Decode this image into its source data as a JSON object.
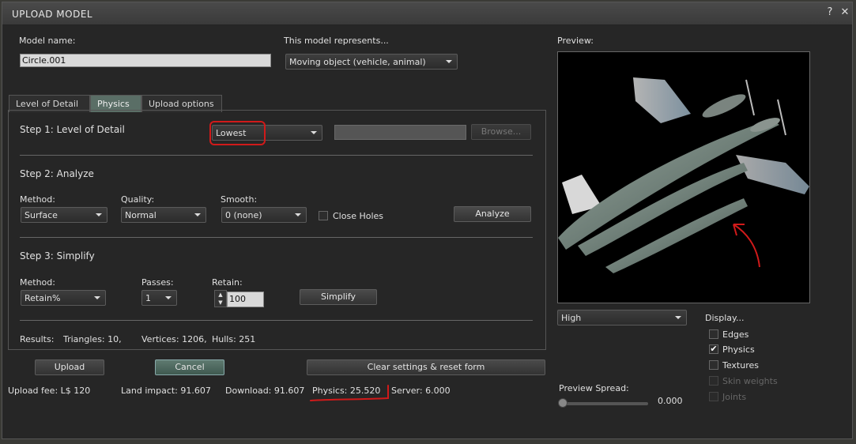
{
  "window": {
    "title": "UPLOAD MODEL",
    "help_glyph": "?",
    "close_glyph": "✕"
  },
  "model": {
    "name_label": "Model name:",
    "name_value": "Circle.001",
    "represents_label": "This model represents...",
    "represents_value": "Moving object (vehicle, animal)"
  },
  "tabs": [
    "Level of Detail",
    "Physics",
    "Upload options"
  ],
  "active_tab": "Physics",
  "step1": {
    "title": "Step 1: Level of Detail",
    "lod_value": "Lowest",
    "browse_label": "Browse..."
  },
  "step2": {
    "title": "Step 2: Analyze",
    "method_label": "Method:",
    "method_value": "Surface",
    "quality_label": "Quality:",
    "quality_value": "Normal",
    "smooth_label": "Smooth:",
    "smooth_value": "0 (none)",
    "close_holes_label": "Close Holes",
    "analyze_label": "Analyze"
  },
  "step3": {
    "title": "Step 3: Simplify",
    "method_label": "Method:",
    "method_value": "Retain%",
    "passes_label": "Passes:",
    "passes_value": "1",
    "retain_label": "Retain:",
    "retain_value": "100",
    "simplify_label": "Simplify"
  },
  "results": {
    "label": "Results:",
    "triangles": "Triangles: 10,",
    "vertices": "Vertices: 1206,",
    "hulls": "Hulls: 251"
  },
  "buttons": {
    "upload": "Upload",
    "cancel": "Cancel",
    "clear": "Clear settings & reset form"
  },
  "stats": {
    "upload_fee": "Upload fee: L$ 120",
    "land_impact": "Land impact: 91.607",
    "download": "Download: 91.607",
    "physics": "Physics: 25.520",
    "server": "Server: 6.000"
  },
  "preview": {
    "label": "Preview:",
    "quality_value": "High",
    "spread_label": "Preview Spread:",
    "spread_value": "0.000",
    "display_label": "Display...",
    "display_options": [
      {
        "label": "Edges",
        "checked": false,
        "enabled": true
      },
      {
        "label": "Physics",
        "checked": true,
        "enabled": true
      },
      {
        "label": "Textures",
        "checked": false,
        "enabled": true
      },
      {
        "label": "Skin weights",
        "checked": false,
        "enabled": false
      },
      {
        "label": "Joints",
        "checked": false,
        "enabled": false
      }
    ]
  },
  "annotations_color": "#d11a1a",
  "accent_tab_color": "#5a6e66"
}
